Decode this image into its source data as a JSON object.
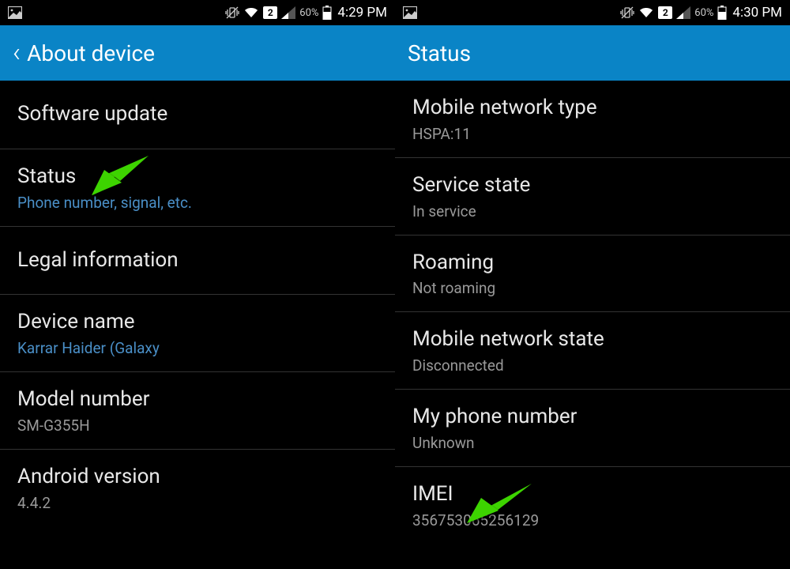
{
  "left": {
    "statusbar": {
      "battery_pct": "60%",
      "time": "4:29 PM",
      "sim": "2"
    },
    "header": {
      "title": "About device"
    },
    "items": [
      {
        "title": "Software update"
      },
      {
        "title": "Status",
        "subtitle": "Phone number, signal, etc."
      },
      {
        "title": "Legal information"
      },
      {
        "title": "Device name",
        "subtitle": "Karrar Haider (Galaxy"
      },
      {
        "title": "Model number",
        "subtitle": "SM-G355H"
      },
      {
        "title": "Android version",
        "subtitle": "4.4.2"
      }
    ]
  },
  "right": {
    "statusbar": {
      "battery_pct": "60%",
      "time": "4:30 PM",
      "sim": "2"
    },
    "header": {
      "title": "Status"
    },
    "items": [
      {
        "title": "Mobile network type",
        "subtitle": "HSPA:11"
      },
      {
        "title": "Service state",
        "subtitle": "In service"
      },
      {
        "title": "Roaming",
        "subtitle": "Not roaming"
      },
      {
        "title": "Mobile network state",
        "subtitle": "Disconnected"
      },
      {
        "title": "My phone number",
        "subtitle": "Unknown"
      },
      {
        "title": "IMEI",
        "subtitle": "356753065256129"
      }
    ]
  },
  "colors": {
    "accent": "#0a84c6",
    "link": "#4a8fc7",
    "arrow": "#3ed400"
  }
}
